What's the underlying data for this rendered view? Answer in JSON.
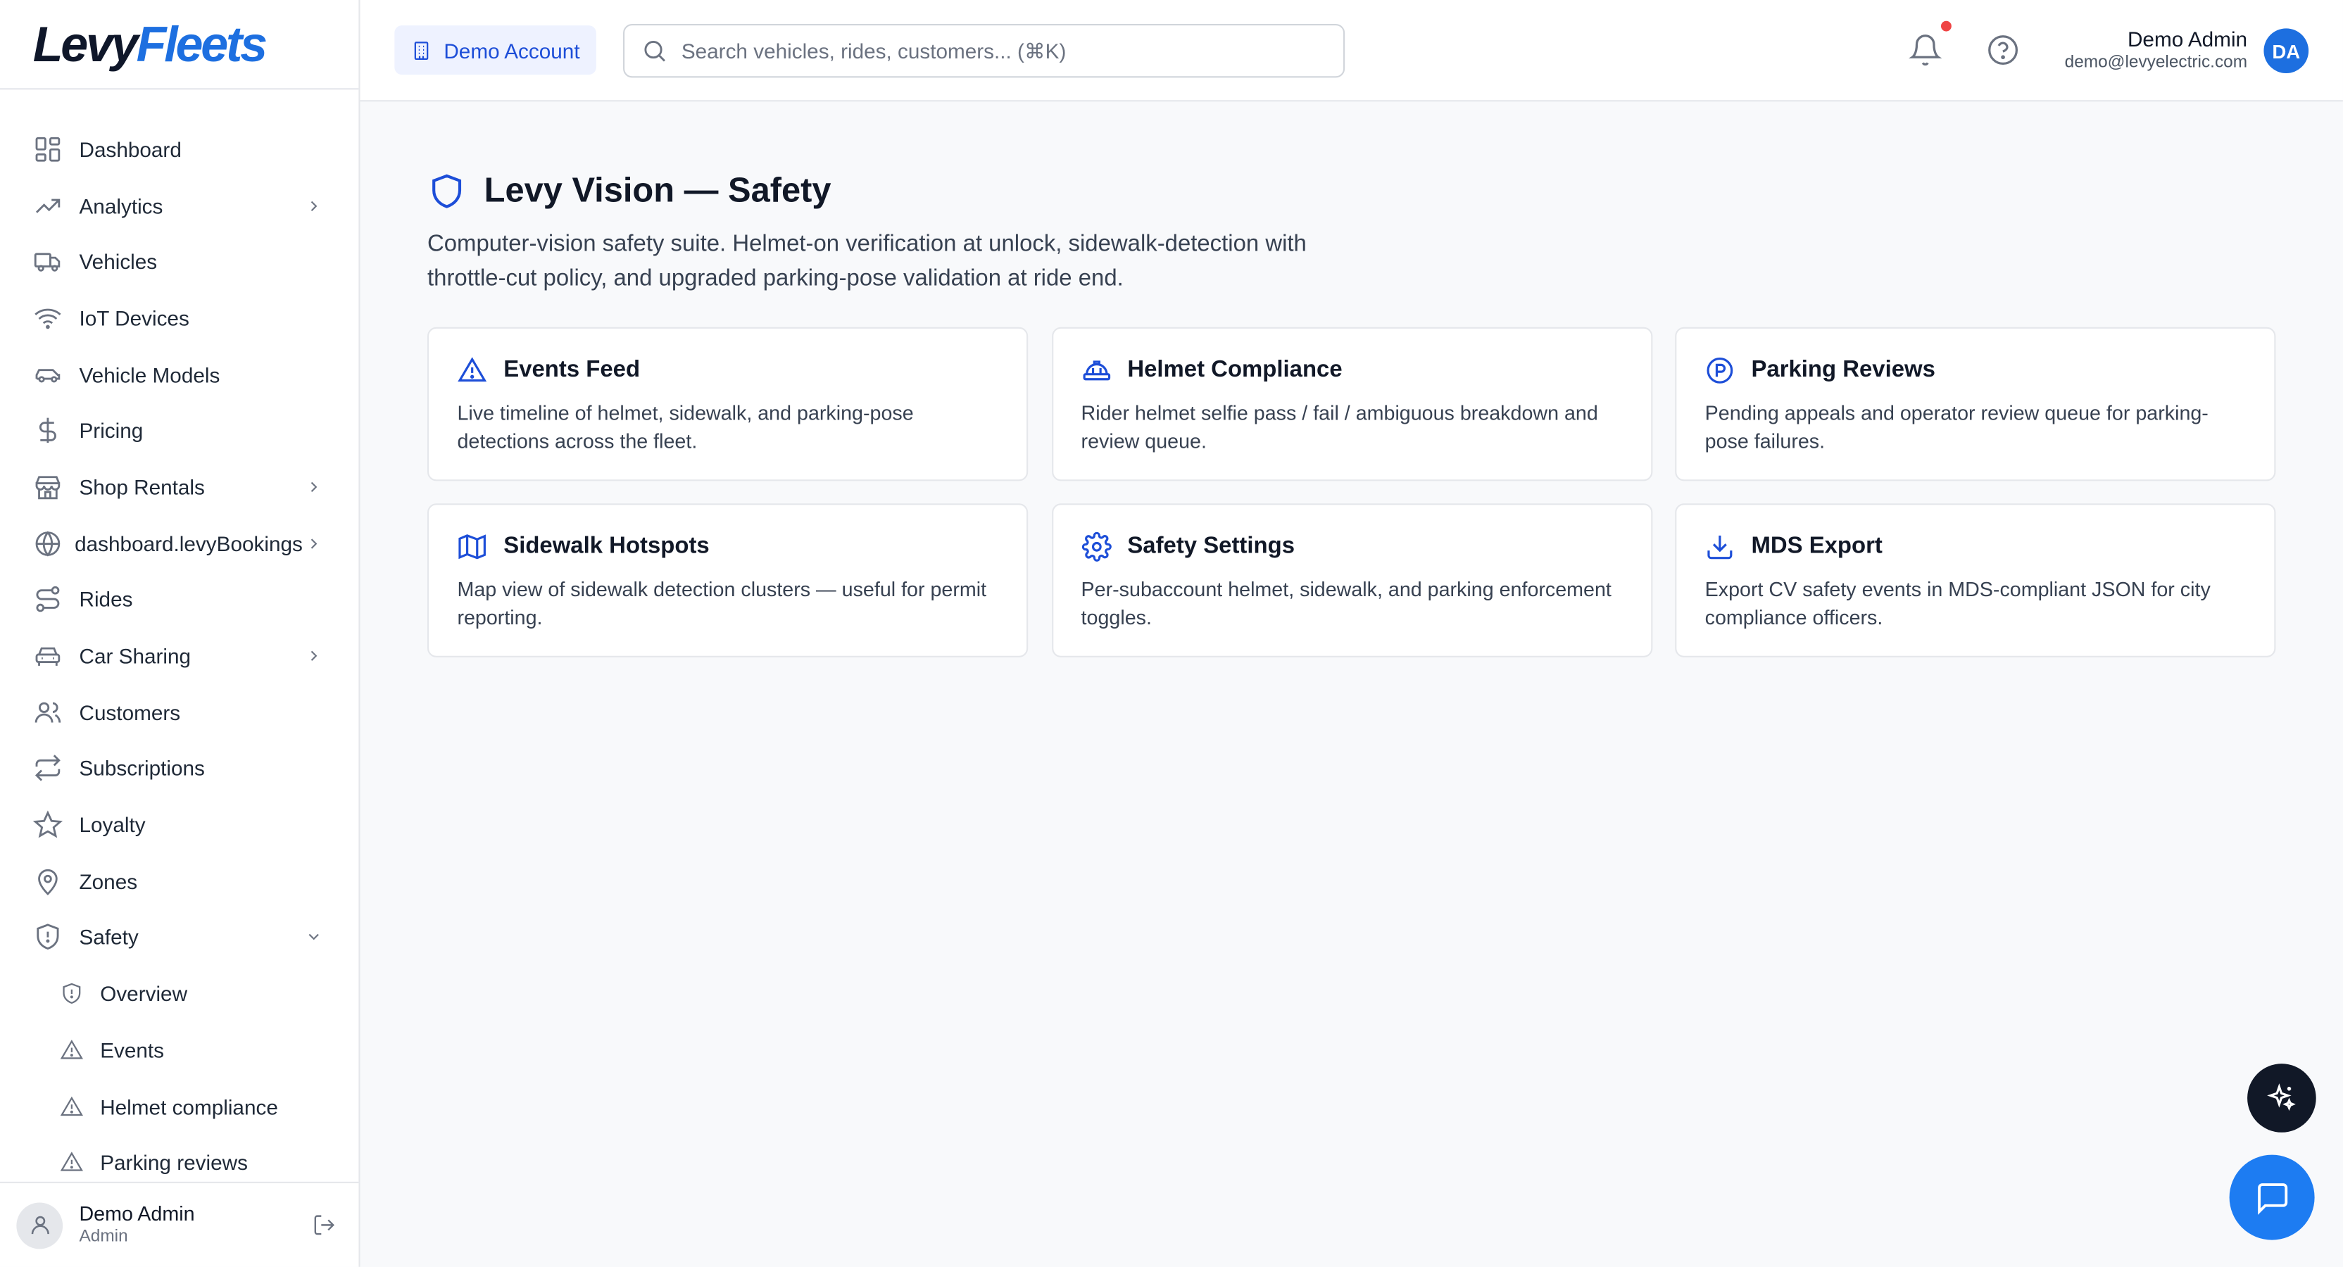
{
  "brand": {
    "levy": "Levy",
    "fleets": "Fleets"
  },
  "sidebar": {
    "items": [
      {
        "label": "Dashboard",
        "icon": "grid-icon"
      },
      {
        "label": "Analytics",
        "icon": "trending-up-icon",
        "chevron": "right"
      },
      {
        "label": "Vehicles",
        "icon": "truck-icon"
      },
      {
        "label": "IoT Devices",
        "icon": "wifi-icon"
      },
      {
        "label": "Vehicle Models",
        "icon": "car-icon"
      },
      {
        "label": "Pricing",
        "icon": "dollar-icon"
      },
      {
        "label": "Shop Rentals",
        "icon": "store-icon",
        "chevron": "right"
      },
      {
        "label": "dashboard.levyBookings",
        "icon": "globe-icon",
        "chevron": "right"
      },
      {
        "label": "Rides",
        "icon": "route-icon"
      },
      {
        "label": "Car Sharing",
        "icon": "car-front-icon",
        "chevron": "right"
      },
      {
        "label": "Customers",
        "icon": "users-icon"
      },
      {
        "label": "Subscriptions",
        "icon": "repeat-icon"
      },
      {
        "label": "Loyalty",
        "icon": "star-icon"
      },
      {
        "label": "Zones",
        "icon": "map-pin-icon"
      },
      {
        "label": "Safety",
        "icon": "shield-icon",
        "chevron": "down"
      }
    ],
    "safety_sub": [
      {
        "label": "Overview",
        "icon": "shield-icon"
      },
      {
        "label": "Events",
        "icon": "alert-triangle-icon"
      },
      {
        "label": "Helmet compliance",
        "icon": "alert-triangle-icon"
      },
      {
        "label": "Parking reviews",
        "icon": "alert-triangle-icon"
      }
    ],
    "footer": {
      "name": "Demo Admin",
      "role": "Admin"
    }
  },
  "header": {
    "account_label": "Demo Account",
    "search_placeholder": "Search vehicles, rides, customers... (⌘K)",
    "user_name": "Demo Admin",
    "user_email": "demo@levyelectric.com",
    "user_initials": "DA"
  },
  "main": {
    "title": "Levy Vision — Safety",
    "description": "Computer-vision safety suite. Helmet-on verification at unlock, sidewalk-detection with throttle-cut policy, and upgraded parking-pose validation at ride end.",
    "cards": [
      {
        "title": "Events Feed",
        "desc": "Live timeline of helmet, sidewalk, and parking-pose detections across the fleet.",
        "icon": "alert-triangle-icon"
      },
      {
        "title": "Helmet Compliance",
        "desc": "Rider helmet selfie pass / fail / ambiguous breakdown and review queue.",
        "icon": "hard-hat-icon"
      },
      {
        "title": "Parking Reviews",
        "desc": "Pending appeals and operator review queue for parking-pose failures.",
        "icon": "parking-icon"
      },
      {
        "title": "Sidewalk Hotspots",
        "desc": "Map view of sidewalk detection clusters — useful for permit reporting.",
        "icon": "map-icon"
      },
      {
        "title": "Safety Settings",
        "desc": "Per-subaccount helmet, sidewalk, and parking enforcement toggles.",
        "icon": "gear-icon"
      },
      {
        "title": "MDS Export",
        "desc": "Export CV safety events in MDS-compliant JSON for city compliance officers.",
        "icon": "download-icon"
      }
    ]
  },
  "colors": {
    "accent": "#1d6fe0",
    "notification": "#ef4444",
    "fab_dark": "#111827",
    "fab_blue": "#1d7cf2"
  }
}
